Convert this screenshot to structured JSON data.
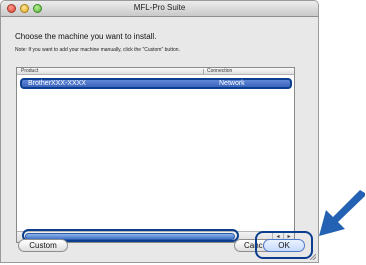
{
  "window": {
    "title": "MFL-Pro Suite"
  },
  "prompt": "Choose the machine you want to install.",
  "note": "Note: If you want to add your machine manually, click the \"Custom\" button.",
  "list": {
    "columns": [
      "Product",
      "Connection"
    ],
    "rows": [
      {
        "name": "BrotherXXX-XXXX",
        "connection": "Network"
      }
    ]
  },
  "scrollbar": {
    "left_arrow": "◂",
    "right_arrow": "▸"
  },
  "buttons": {
    "custom": "Custom",
    "cancel": "Cancel",
    "ok": "OK"
  },
  "colors": {
    "highlight": "#0b3e8f",
    "selection": "#3c65bd",
    "pointer": "#2361b3"
  }
}
